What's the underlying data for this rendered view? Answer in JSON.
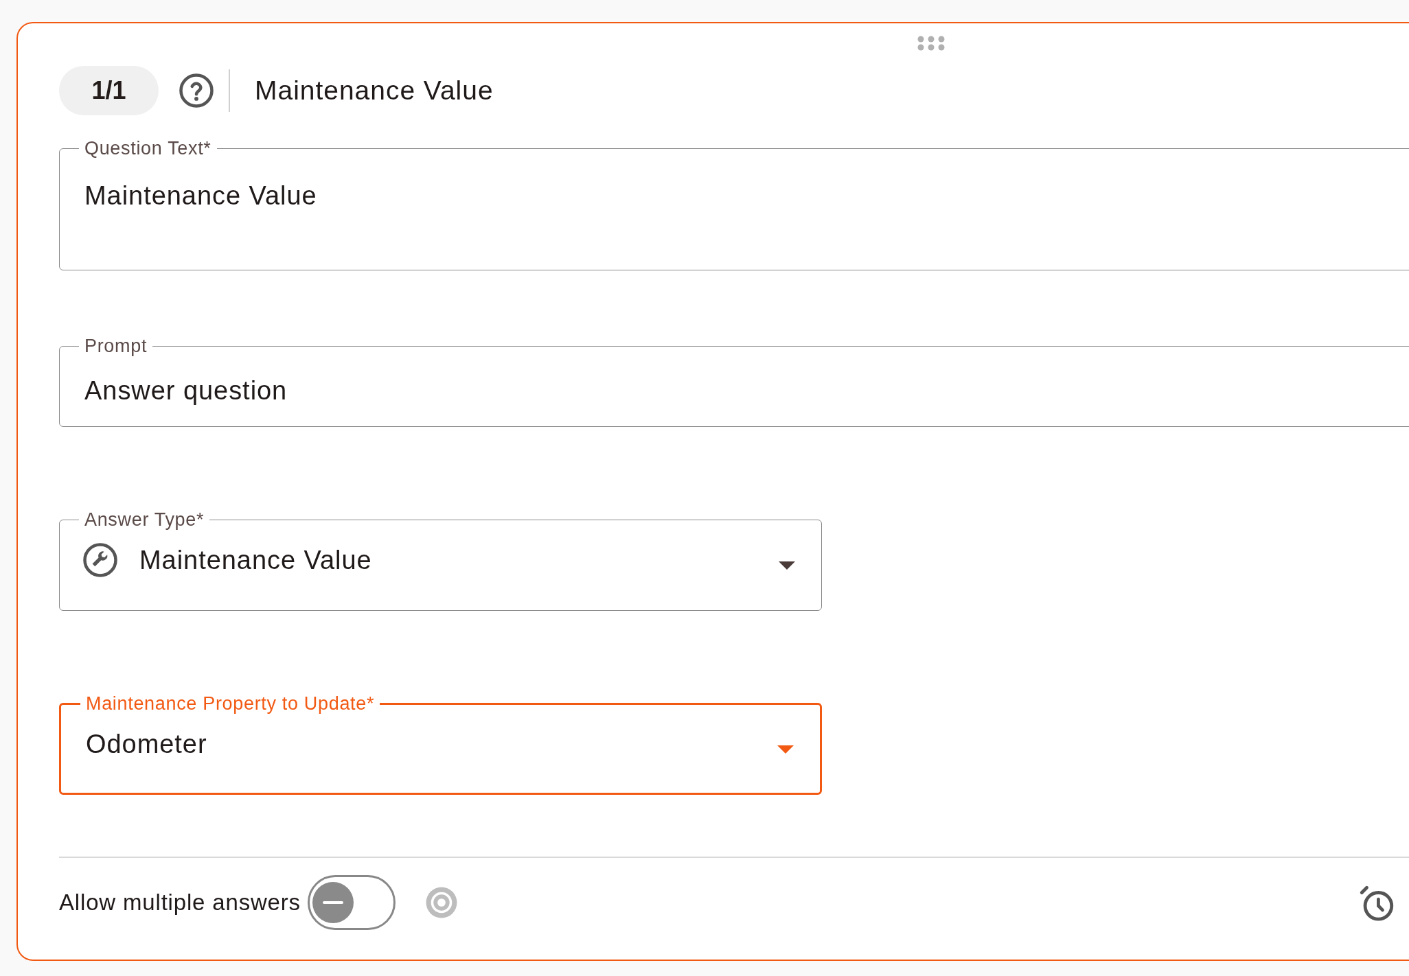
{
  "header": {
    "counter": "1/1",
    "title": "Maintenance Value"
  },
  "fields": [
    {
      "kind": "textarea",
      "label": "Question Text*",
      "value": "Maintenance Value",
      "focused": false
    },
    {
      "kind": "text",
      "label": "Prompt",
      "value": "Answer question",
      "focused": false
    },
    {
      "kind": "icon-select",
      "label": "Answer Type*",
      "value": "Maintenance Value",
      "focused": false
    },
    {
      "kind": "select",
      "label": "Maintenance Property to Update*",
      "value": "Odometer",
      "focused": true
    }
  ],
  "footer": {
    "toggle": {
      "label": "Allow multiple answers",
      "on": false
    }
  }
}
